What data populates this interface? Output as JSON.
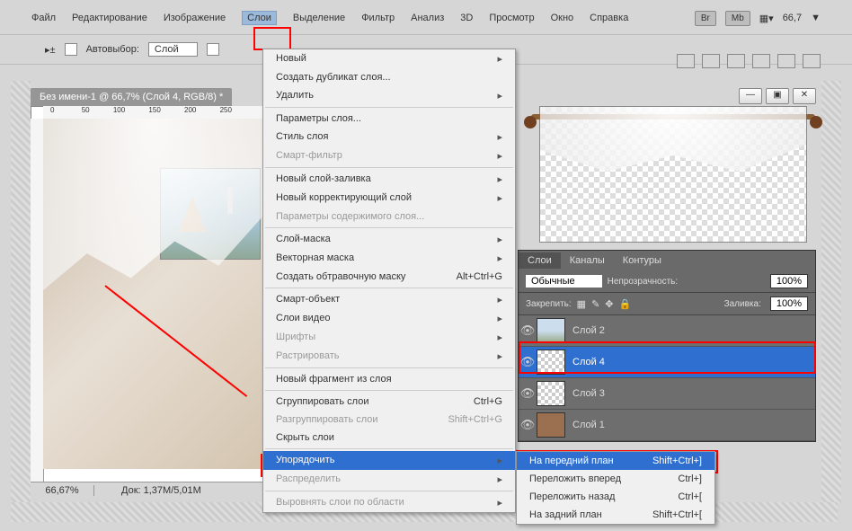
{
  "menu": {
    "items": [
      "Файл",
      "Редактирование",
      "Изображение",
      "Слои",
      "Выделение",
      "Фильтр",
      "Анализ",
      "3D",
      "Просмотр",
      "Окно",
      "Справка"
    ],
    "active_index": 3,
    "zoom_value": "66,7"
  },
  "toolbar": {
    "autoselect_label": "Автовыбор:",
    "autoselect_value": "Слой"
  },
  "document": {
    "tab_title": "Без имени-1 @ 66,7% (Слой 4, RGB/8) *",
    "ruler_marks": [
      "0",
      "50",
      "100",
      "150",
      "200",
      "250"
    ],
    "zoom": "66,67%",
    "doc_size": "Док: 1,37M/5,01M"
  },
  "dropdown": [
    {
      "label": "Новый",
      "arrow": true
    },
    {
      "label": "Создать дубликат слоя..."
    },
    {
      "label": "Удалить",
      "arrow": true
    },
    {
      "sep": true
    },
    {
      "label": "Параметры слоя..."
    },
    {
      "label": "Стиль слоя",
      "arrow": true
    },
    {
      "label": "Смарт-фильтр",
      "arrow": true,
      "disabled": true
    },
    {
      "sep": true
    },
    {
      "label": "Новый слой-заливка",
      "arrow": true
    },
    {
      "label": "Новый корректирующий слой",
      "arrow": true
    },
    {
      "label": "Параметры содержимого слоя...",
      "disabled": true
    },
    {
      "sep": true
    },
    {
      "label": "Слой-маска",
      "arrow": true
    },
    {
      "label": "Векторная маска",
      "arrow": true
    },
    {
      "label": "Создать обтравочную маску",
      "shortcut": "Alt+Ctrl+G"
    },
    {
      "sep": true
    },
    {
      "label": "Смарт-объект",
      "arrow": true
    },
    {
      "label": "Слои видео",
      "arrow": true
    },
    {
      "label": "Шрифты",
      "arrow": true,
      "disabled": true
    },
    {
      "label": "Растрировать",
      "arrow": true,
      "disabled": true
    },
    {
      "sep": true
    },
    {
      "label": "Новый фрагмент из слоя"
    },
    {
      "sep": true
    },
    {
      "label": "Сгруппировать слои",
      "shortcut": "Ctrl+G"
    },
    {
      "label": "Разгруппировать слои",
      "shortcut": "Shift+Ctrl+G",
      "disabled": true
    },
    {
      "label": "Скрыть слои"
    },
    {
      "sep": true
    },
    {
      "label": "Упорядочить",
      "arrow": true,
      "selected": true
    },
    {
      "label": "Распределить",
      "arrow": true,
      "disabled": true
    },
    {
      "sep": true
    },
    {
      "label": "Выровнять слои по области",
      "arrow": true,
      "disabled": true
    }
  ],
  "submenu": [
    {
      "label": "На передний план",
      "shortcut": "Shift+Ctrl+]",
      "selected": true
    },
    {
      "label": "Переложить вперед",
      "shortcut": "Ctrl+]"
    },
    {
      "label": "Переложить назад",
      "shortcut": "Ctrl+["
    },
    {
      "label": "На задний план",
      "shortcut": "Shift+Ctrl+["
    }
  ],
  "layers_panel": {
    "tabs": [
      "Слои",
      "Каналы",
      "Контуры"
    ],
    "blend_mode": "Обычные",
    "opacity_label": "Непрозрачность:",
    "opacity_value": "100%",
    "lock_label": "Закрепить:",
    "fill_label": "Заливка:",
    "fill_value": "100%",
    "layers": [
      {
        "name": "Слой 2",
        "thumb": "scene"
      },
      {
        "name": "Слой 4",
        "thumb": "checker",
        "selected": true
      },
      {
        "name": "Слой 3",
        "thumb": "checker"
      },
      {
        "name": "Слой 1",
        "thumb": "brown"
      }
    ]
  },
  "icons": {
    "br": "Br",
    "mb": "Mb"
  }
}
